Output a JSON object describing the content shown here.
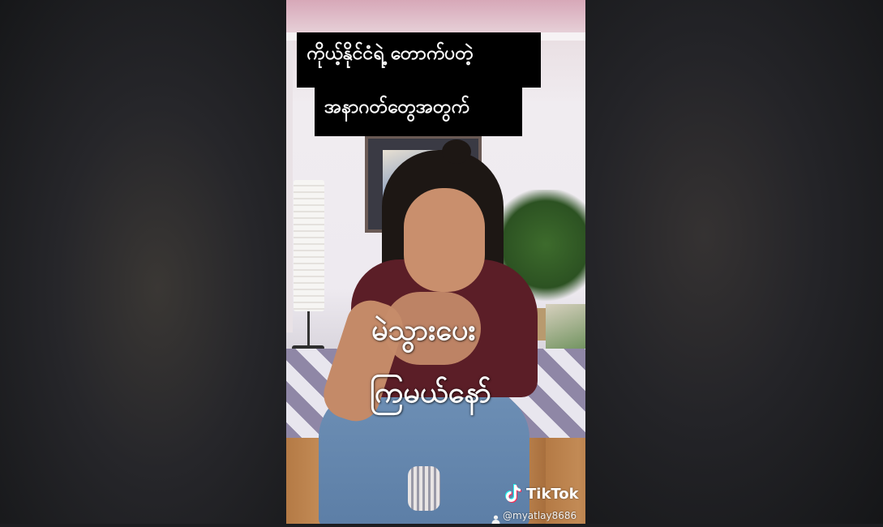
{
  "video": {
    "caption_line_1": "ကိုယ့်နိုင်ငံရဲ့ တောက်ပတဲ့",
    "caption_line_2": "အနာဂတ်တွေအတွက်",
    "overlay_line_1": "မဲသွားပေး",
    "overlay_line_2": "ကြမယ်နော်"
  },
  "watermark": {
    "brand": "TikTok",
    "brand_icon": "tiktok-note-icon",
    "user_icon": "user-icon",
    "handle": "@myatlay8686"
  },
  "colors": {
    "backdrop": "#1c1d20",
    "caption_bg": "#000000",
    "caption_text": "#ffffff"
  }
}
